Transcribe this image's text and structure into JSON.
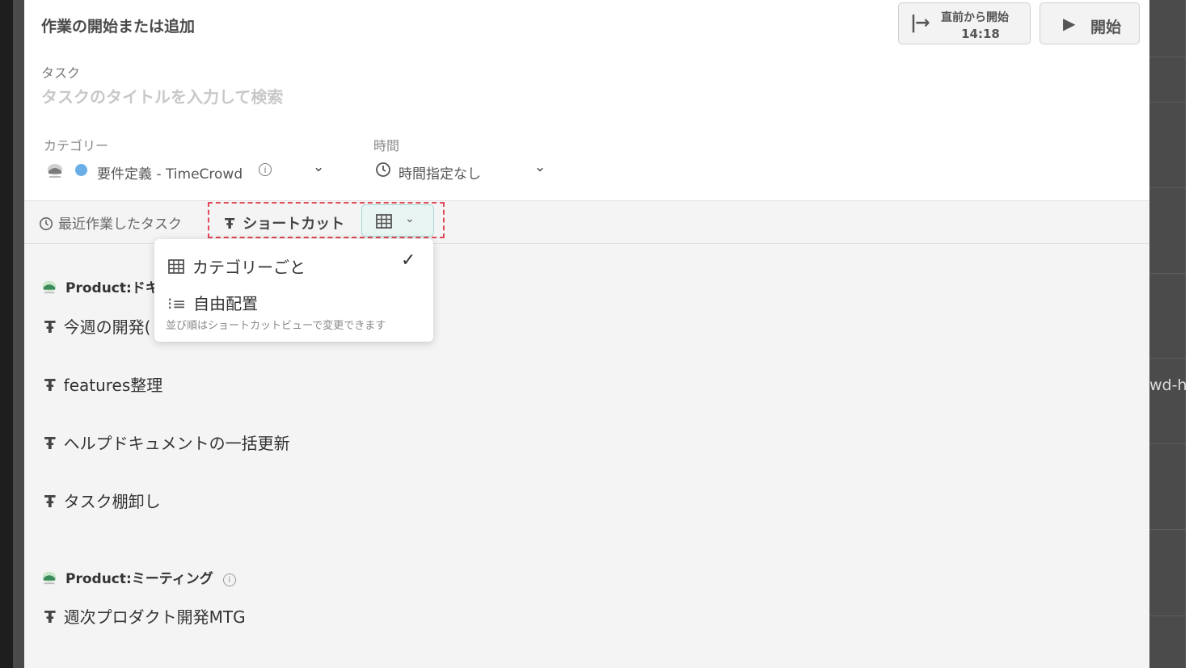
{
  "background": {
    "right_text": "wd-h"
  },
  "modal": {
    "title": "作業の開始または追加",
    "resume_button": {
      "line1": "直前から開始",
      "line2": "14:18",
      "icon": "arrow-from-bar-icon"
    },
    "start_button": {
      "label": "開始",
      "icon": "play-icon"
    },
    "task": {
      "label": "タスク",
      "placeholder": "タスクのタイトルを入力して検索"
    },
    "category": {
      "label": "カテゴリー",
      "value": "要件定義 - TimeCrowd",
      "dot_color": "#6aaee8"
    },
    "time": {
      "label": "時間",
      "value": "時間指定なし"
    }
  },
  "tabs": {
    "recent": "最近作業したタスク",
    "shortcut": "ショートカット"
  },
  "view_menu": {
    "option1": "カテゴリーごと",
    "option2": "自由配置",
    "hint": "並び順はショートカットビューで変更できます",
    "selected": "カテゴリーごと"
  },
  "groups": [
    {
      "name": "Product:ドキ",
      "items": [
        "今週の開発(",
        "features整理",
        "ヘルプドキュメントの一括更新",
        "タスク棚卸し"
      ]
    },
    {
      "name": "Product:ミーティング",
      "items": [
        "週次プロダクト開発MTG"
      ]
    }
  ],
  "colors": {
    "accent_dashed": "#e04a5a",
    "toggle_bg": "#e8f5f3"
  }
}
